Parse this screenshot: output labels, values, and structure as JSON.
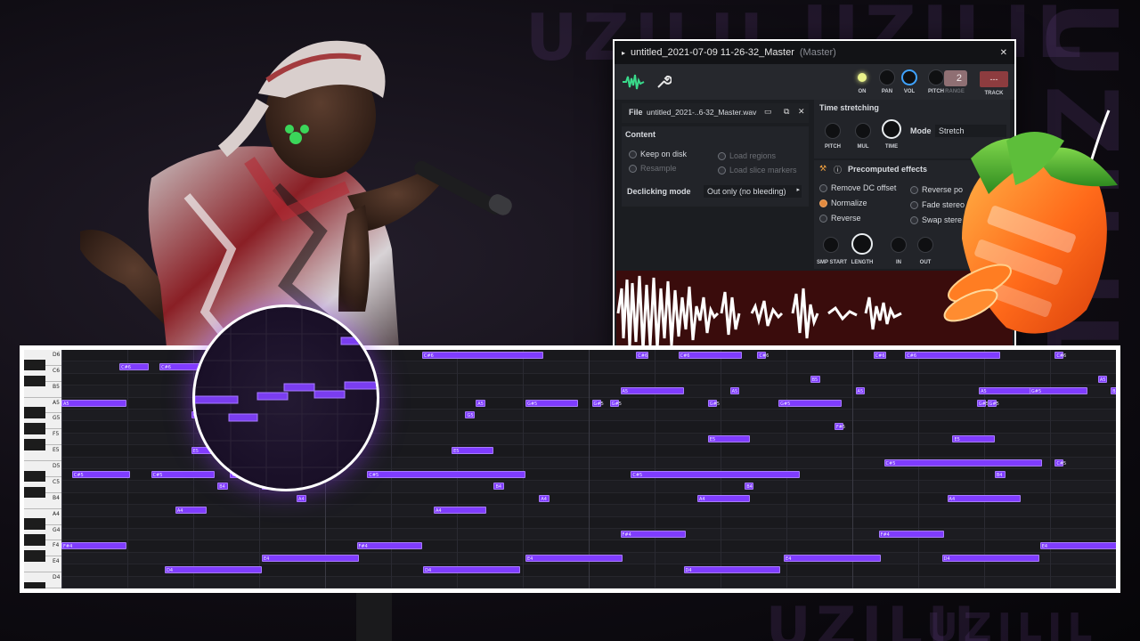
{
  "watermark": {
    "text": "UZILIL"
  },
  "plugin": {
    "title": "untitled_2021-07-09 11-26-32_Master",
    "title_suffix": "(Master)",
    "knobs": {
      "on": "ON",
      "pan": "PAN",
      "vol": "VOL",
      "pitch": "PITCH",
      "range": "RANGE",
      "range_value": "2",
      "track": "TRACK",
      "track_value": "---"
    },
    "file": {
      "label": "File",
      "value": "untitled_2021-..6-32_Master.wav"
    },
    "content": {
      "header": "Content",
      "keep_on_disk": "Keep on disk",
      "resample": "Resample",
      "load_regions": "Load regions",
      "load_slice_markers": "Load slice markers",
      "declicking_label": "Declicking mode",
      "declicking_value": "Out only (no bleeding)"
    },
    "time_stretching": {
      "header": "Time stretching",
      "pitch": "PITCH",
      "mul": "MUL",
      "time": "TIME",
      "mode_label": "Mode",
      "mode_value": "Stretch"
    },
    "precomputed": {
      "header": "Precomputed effects",
      "remove_dc": "Remove DC offset",
      "normalize": "Normalize",
      "reverse": "Reverse",
      "reverse_polarity": "Reverse po",
      "fade_stereo": "Fade stereo",
      "swap_stereo": "Swap stere",
      "smp_start": "SMP START",
      "length": "LENGTH",
      "in": "IN",
      "out": "OUT"
    }
  },
  "piano_roll": {
    "keys": [
      "D6",
      "C6",
      "B5",
      "A5",
      "G5",
      "F5",
      "E5",
      "D5",
      "C5",
      "B4",
      "A4",
      "G4",
      "F4",
      "E4",
      "D4"
    ],
    "notes": [
      {
        "label": "C#6",
        "row": 1,
        "start": 0.055,
        "len": 0.028
      },
      {
        "label": "C#6",
        "row": 1,
        "start": 0.093,
        "len": 0.055
      },
      {
        "label": "A5",
        "row": 4,
        "start": 0.0,
        "len": 0.062
      },
      {
        "label": "G5",
        "row": 5,
        "start": 0.123,
        "len": 0.009
      },
      {
        "label": "A5",
        "row": 4,
        "start": 0.133,
        "len": 0.009
      },
      {
        "label": "E5",
        "row": 8,
        "start": 0.123,
        "len": 0.045
      },
      {
        "label": "C#5",
        "row": 10,
        "start": 0.01,
        "len": 0.055
      },
      {
        "label": "C#5",
        "row": 10,
        "start": 0.085,
        "len": 0.06
      },
      {
        "label": "C#5",
        "row": 10,
        "start": 0.16,
        "len": 0.03
      },
      {
        "label": "B4",
        "row": 11,
        "start": 0.148,
        "len": 0.01
      },
      {
        "label": "A4",
        "row": 13,
        "start": 0.108,
        "len": 0.03
      },
      {
        "label": "F#4",
        "row": 16,
        "start": 0.0,
        "len": 0.062
      },
      {
        "label": "E4",
        "row": 17,
        "start": 0.19,
        "len": 0.092
      },
      {
        "label": "D4",
        "row": 18,
        "start": 0.098,
        "len": 0.092
      },
      {
        "label": "B4",
        "row": 11,
        "start": 0.19,
        "len": 0.018
      },
      {
        "label": "A4",
        "row": 12,
        "start": 0.223,
        "len": 0.009
      },
      {
        "label": "C#6",
        "row": 0,
        "start": 0.342,
        "len": 0.115
      },
      {
        "label": "G5",
        "row": 5,
        "start": 0.383,
        "len": 0.009
      },
      {
        "label": "A5",
        "row": 4,
        "start": 0.393,
        "len": 0.009
      },
      {
        "label": "E5",
        "row": 8,
        "start": 0.37,
        "len": 0.04
      },
      {
        "label": "C#5",
        "row": 10,
        "start": 0.29,
        "len": 0.15
      },
      {
        "label": "B4",
        "row": 11,
        "start": 0.41,
        "len": 0.01
      },
      {
        "label": "A4",
        "row": 12,
        "start": 0.453,
        "len": 0.01
      },
      {
        "label": "A4",
        "row": 13,
        "start": 0.353,
        "len": 0.05
      },
      {
        "label": "F#4",
        "row": 16,
        "start": 0.28,
        "len": 0.062
      },
      {
        "label": "E4",
        "row": 17,
        "start": 0.44,
        "len": 0.092
      },
      {
        "label": "D4",
        "row": 18,
        "start": 0.343,
        "len": 0.092
      },
      {
        "label": "G#5",
        "row": 4,
        "start": 0.44,
        "len": 0.05
      },
      {
        "label": "G#5",
        "row": 4,
        "start": 0.503,
        "len": 0.008
      },
      {
        "label": "G#5",
        "row": 4,
        "start": 0.52,
        "len": 0.008
      },
      {
        "label": "A5",
        "row": 3,
        "start": 0.53,
        "len": 0.06
      },
      {
        "label": "C#6",
        "row": 0,
        "start": 0.545,
        "len": 0.012
      },
      {
        "label": "C#6",
        "row": 0,
        "start": 0.585,
        "len": 0.06
      },
      {
        "label": "G#5",
        "row": 4,
        "start": 0.613,
        "len": 0.008
      },
      {
        "label": "A5",
        "row": 3,
        "start": 0.634,
        "len": 0.008
      },
      {
        "label": "E5",
        "row": 7,
        "start": 0.613,
        "len": 0.04
      },
      {
        "label": "C#5",
        "row": 10,
        "start": 0.54,
        "len": 0.16
      },
      {
        "label": "B4",
        "row": 11,
        "start": 0.648,
        "len": 0.008
      },
      {
        "label": "A4",
        "row": 12,
        "start": 0.603,
        "len": 0.05
      },
      {
        "label": "F#4",
        "row": 15,
        "start": 0.53,
        "len": 0.062
      },
      {
        "label": "E4",
        "row": 17,
        "start": 0.685,
        "len": 0.092
      },
      {
        "label": "D4",
        "row": 18,
        "start": 0.59,
        "len": 0.092
      },
      {
        "label": "C#6",
        "row": 0,
        "start": 0.66,
        "len": 0.008
      },
      {
        "label": "B5",
        "row": 2,
        "start": 0.71,
        "len": 0.01
      },
      {
        "label": "G#5",
        "row": 4,
        "start": 0.68,
        "len": 0.06
      },
      {
        "label": "C#6",
        "row": 0,
        "start": 0.77,
        "len": 0.012
      },
      {
        "label": "C#6",
        "row": 0,
        "start": 0.8,
        "len": 0.09
      },
      {
        "label": "F#5",
        "row": 6,
        "start": 0.733,
        "len": 0.008
      },
      {
        "label": "A5",
        "row": 3,
        "start": 0.753,
        "len": 0.008
      },
      {
        "label": "A5",
        "row": 3,
        "start": 0.87,
        "len": 0.06
      },
      {
        "label": "G#5",
        "row": 4,
        "start": 0.868,
        "len": 0.008
      },
      {
        "label": "E5",
        "row": 7,
        "start": 0.845,
        "len": 0.04
      },
      {
        "label": "C#5",
        "row": 9,
        "start": 0.78,
        "len": 0.15
      },
      {
        "label": "B4",
        "row": 10,
        "start": 0.885,
        "len": 0.01
      },
      {
        "label": "A4",
        "row": 12,
        "start": 0.84,
        "len": 0.07
      },
      {
        "label": "F#4",
        "row": 15,
        "start": 0.775,
        "len": 0.062
      },
      {
        "label": "E4",
        "row": 16,
        "start": 0.928,
        "len": 0.092
      },
      {
        "label": "D4",
        "row": 17,
        "start": 0.835,
        "len": 0.092
      },
      {
        "label": "C#6",
        "row": 0,
        "start": 0.942,
        "len": 0.008
      },
      {
        "label": "G#5",
        "row": 3,
        "start": 0.918,
        "len": 0.055
      },
      {
        "label": "A5",
        "row": 2,
        "start": 0.983,
        "len": 0.008
      },
      {
        "label": "B5",
        "row": 3,
        "start": 0.995,
        "len": 0.008
      },
      {
        "label": "G#5",
        "row": 4,
        "start": 0.878,
        "len": 0.008
      },
      {
        "label": "C#5",
        "row": 9,
        "start": 0.942,
        "len": 0.008
      }
    ]
  }
}
